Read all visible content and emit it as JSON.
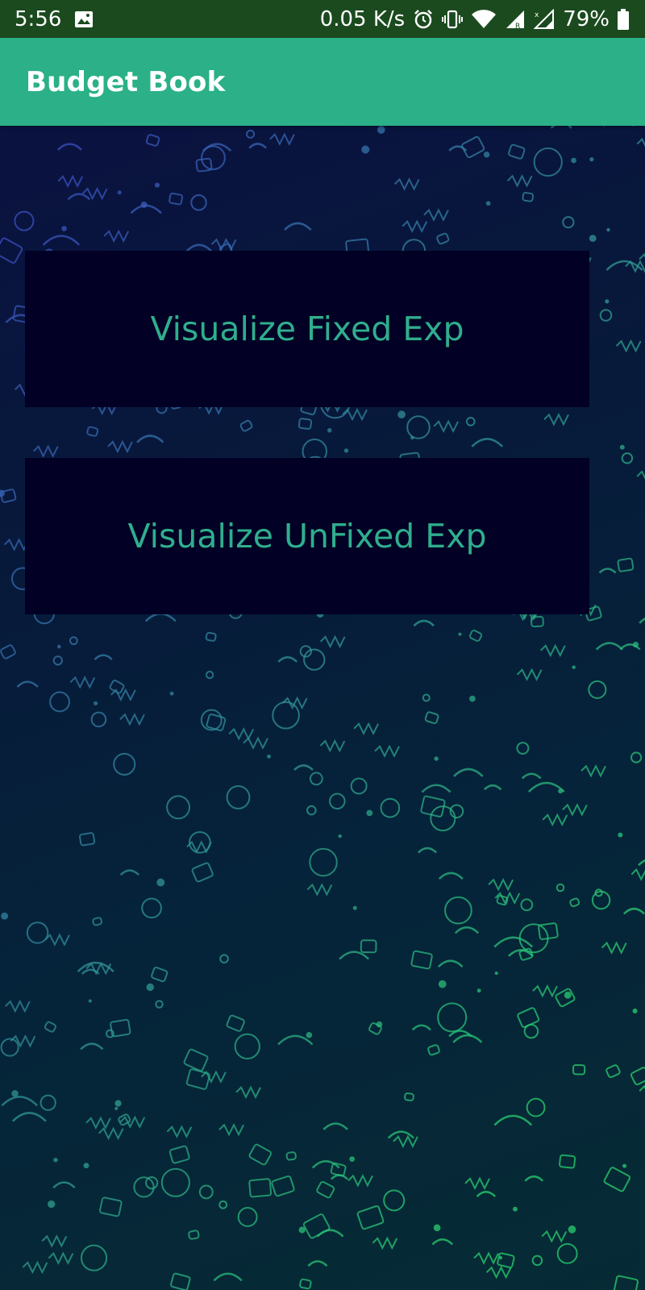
{
  "status_bar": {
    "time": "5:56",
    "network_speed": "0.05 K/s",
    "battery_percent": "79%",
    "icons": [
      "image-icon",
      "alarm-icon",
      "vibrate-icon",
      "wifi-icon",
      "signal-r-icon",
      "signal-x-icon",
      "battery-icon"
    ]
  },
  "app_bar": {
    "title": "Budget Book",
    "color": "#2bb087"
  },
  "main": {
    "buttons": [
      {
        "label": "Visualize Fixed Exp"
      },
      {
        "label": "Visualize UnFixed Exp"
      }
    ],
    "button_background": "#020024",
    "button_text_color": "#2fae8d"
  },
  "wallpaper": {
    "description_icons": [
      "doodle-pattern"
    ]
  }
}
